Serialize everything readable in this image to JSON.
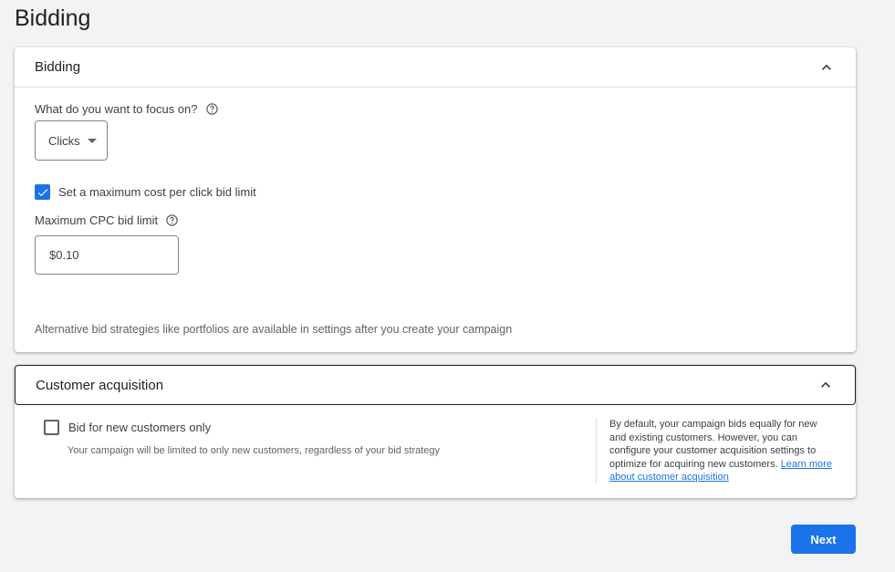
{
  "page": {
    "title": "Bidding"
  },
  "bidding": {
    "header": "Bidding",
    "focus_label": "What do you want to focus on?",
    "focus_value": "Clicks",
    "max_cpc_checkbox_label": "Set a maximum cost per click bid limit",
    "max_cpc_checked": true,
    "max_cpc_label": "Maximum CPC bid limit",
    "max_cpc_value": "$0.10",
    "alt_note": "Alternative bid strategies like portfolios are available in settings after you create your campaign"
  },
  "customer_acquisition": {
    "header": "Customer acquisition",
    "checkbox_label": "Bid for new customers only",
    "checkbox_checked": false,
    "sub_text": "Your campaign will be limited to only new customers, regardless of your bid strategy",
    "info_text": "By default, your campaign bids equally for new and existing customers. However, you can configure your customer acquisition settings to optimize for acquiring new customers.",
    "learn_more_link": "Learn more about customer acquisition"
  },
  "footer": {
    "next_label": "Next"
  },
  "colors": {
    "accent": "#1a73e8",
    "background": "#f1f3f4",
    "text": "#3c4043"
  },
  "icons": {
    "collapse": "chevron-up-icon",
    "help": "help-circle-icon",
    "dropdown": "caret-down-icon",
    "check": "check-icon"
  }
}
